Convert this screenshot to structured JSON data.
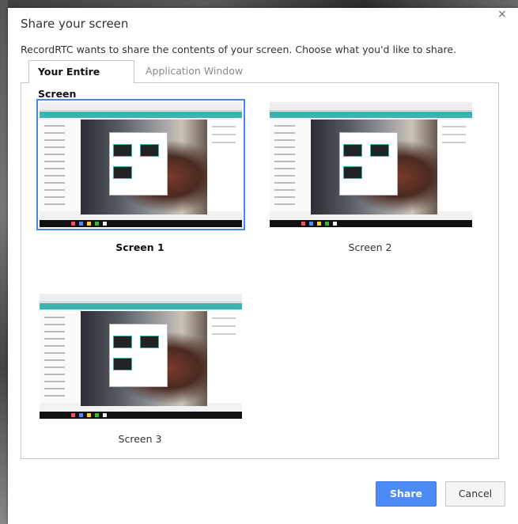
{
  "dialog": {
    "title": "Share your screen",
    "description": "RecordRTC wants to share the contents of your screen. Choose what you'd like to share.",
    "close_glyph": "×"
  },
  "tabs": [
    {
      "label": "Your Entire Screen",
      "active": true
    },
    {
      "label": "Application Window",
      "active": false
    }
  ],
  "screens": [
    {
      "label": "Screen 1",
      "selected": true
    },
    {
      "label": "Screen 2",
      "selected": false
    },
    {
      "label": "Screen 3",
      "selected": false
    }
  ],
  "buttons": {
    "share_label": "Share",
    "cancel_label": "Cancel"
  },
  "colors": {
    "accent": "#4c8bf5",
    "selection_border": "#4a86e8",
    "teal_app_bar": "#3bb3b0"
  }
}
